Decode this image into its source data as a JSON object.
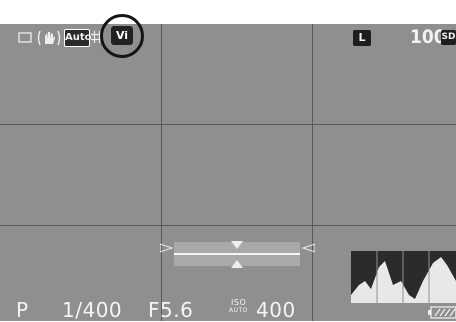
{
  "top_bar": {
    "drive_icon": "single-frame-icon",
    "shake_icon": "shake-reduction-icon",
    "af_label": "Auto",
    "grid_icon": "grid-icon",
    "custom_image_label": "Vi",
    "image_size_label": "L",
    "remaining_shots": "100",
    "card_label": "SD"
  },
  "bottom_bar": {
    "exposure_mode": "P",
    "shutter_speed": "1/400",
    "aperture": "F5.6",
    "iso_label": "ISO",
    "iso_auto_label": "AUTO",
    "iso_value": "400",
    "battery_icon": "battery-icon"
  },
  "level_indicator": {
    "icon": "electronic-level-icon"
  },
  "histogram": {
    "icon": "histogram-icon"
  },
  "colors": {
    "screen_bg": "#8f8f8f",
    "grid": "#5a5a5a",
    "text": "#f2f2f2"
  }
}
